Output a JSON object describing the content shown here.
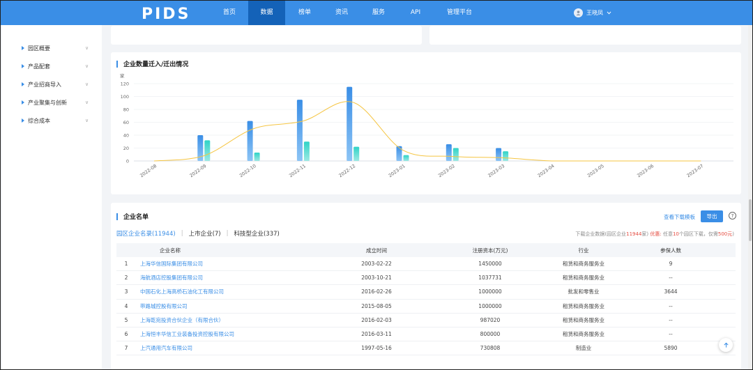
{
  "nav": {
    "logo": "PIDS",
    "items": [
      {
        "label": "首页"
      },
      {
        "label": "数据"
      },
      {
        "label": "榜单"
      },
      {
        "label": "资讯"
      },
      {
        "label": "服务"
      },
      {
        "label": "API"
      },
      {
        "label": "管理平台"
      }
    ],
    "active": "数据",
    "user": "王晓凤",
    "accent": "#3a8ee6",
    "active_bg": "#1462b8"
  },
  "sidebar": {
    "items": [
      {
        "label": "园区概要"
      },
      {
        "label": "产品配套"
      },
      {
        "label": "产业招商导入"
      },
      {
        "label": "产业聚集与创新"
      },
      {
        "label": "综合成本"
      }
    ]
  },
  "migration": {
    "title": "企业数量迁入/迁出情况"
  },
  "chart_data": {
    "type": "bar",
    "title": "企业数量迁入/迁出情况",
    "ylabel": "家",
    "ylim": [
      0,
      120
    ],
    "yticks": [
      0,
      20,
      40,
      60,
      80,
      100,
      120
    ],
    "categories": [
      "2022-08",
      "2022-09",
      "2022-10",
      "2022-11",
      "2022-12",
      "2023-01",
      "2023-02",
      "2023-03",
      "2023-04",
      "2023-05",
      "2023-06",
      "2023-07"
    ],
    "series": [
      {
        "values": [
          0,
          40,
          62,
          95,
          115,
          23,
          26,
          20,
          0,
          0,
          0,
          0
        ],
        "color": "#3a8ee6"
      },
      {
        "values": [
          0,
          32,
          13,
          30,
          22,
          9,
          20,
          15,
          0,
          0,
          0,
          0
        ],
        "color": "#2fd3c7"
      },
      {
        "type": "line",
        "values": [
          0,
          8,
          50,
          62,
          91,
          17,
          7,
          5,
          0,
          0,
          0,
          0
        ],
        "color": "#f5c542"
      }
    ],
    "grid": true
  },
  "company_list": {
    "title": "企业名单",
    "template_link": "查看下载模板",
    "export_label": "导出",
    "help_icon": "question-circle-icon",
    "tabs": [
      "园区企业名录(11944)",
      "上市企业(7)",
      "科技型企业(337)"
    ],
    "download_note_prefix": "下载企业数据(园区企业",
    "download_note_count": "11944",
    "download_note_mid": "家)",
    "download_note_offer": "优惠: ",
    "download_note_rest_a": "任意",
    "download_note_rest_b": "个园区下载，仅需",
    "download_note_price": "500元",
    "download_note_end": ")",
    "columns": [
      "",
      "企业名称",
      "成立时间",
      "注册资本(万元)",
      "行业",
      "参保人数"
    ],
    "rows": [
      {
        "n": "1",
        "name": "上海华信国际集团有限公司",
        "date": "2003-02-22",
        "capital": "1450000",
        "industry": "租赁和商务服务业",
        "staff": "9"
      },
      {
        "n": "2",
        "name": "海航酒店控股集团有限公司",
        "date": "2003-10-21",
        "capital": "1037731",
        "industry": "租赁和商务服务业",
        "staff": "--"
      },
      {
        "n": "3",
        "name": "中国石化上海高桥石油化工有限公司",
        "date": "2016-02-26",
        "capital": "1000000",
        "industry": "批发和零售业",
        "staff": "3644"
      },
      {
        "n": "4",
        "name": "带路城控股有限公司",
        "date": "2015-08-05",
        "capital": "1000000",
        "industry": "租赁和商务服务业",
        "staff": "--"
      },
      {
        "n": "5",
        "name": "上海乾宛投资合伙企业（有限合伙）",
        "date": "2016-02-03",
        "capital": "987020",
        "industry": "租赁和商务服务业",
        "staff": "--"
      },
      {
        "n": "6",
        "name": "上海恒丰华信工业装备投资控股有限公司",
        "date": "2016-03-11",
        "capital": "800000",
        "industry": "租赁和商务服务业",
        "staff": "--"
      },
      {
        "n": "7",
        "name": "上汽通用汽车有限公司",
        "date": "1997-05-16",
        "capital": "730808",
        "industry": "制造业",
        "staff": "5890"
      }
    ]
  }
}
